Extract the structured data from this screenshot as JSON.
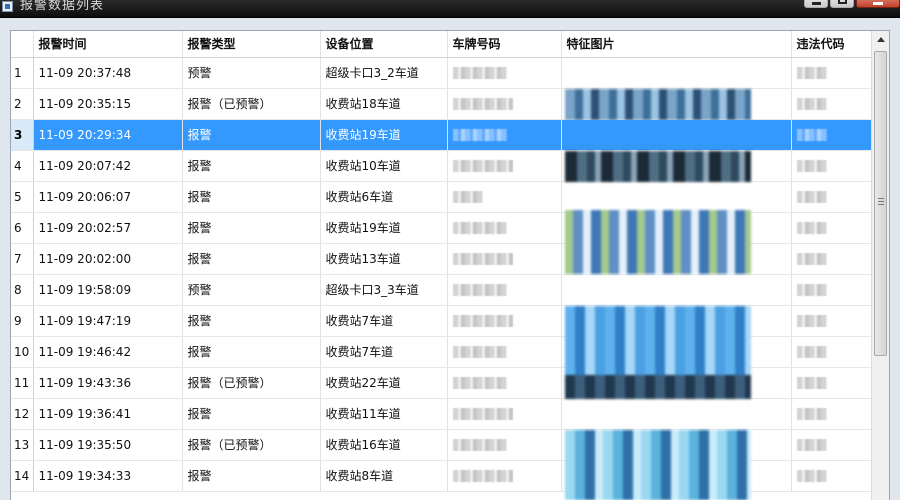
{
  "window": {
    "title": "报警数据列表"
  },
  "table": {
    "headers": [
      "",
      "报警时间",
      "报警类型",
      "设备位置",
      "车牌号码",
      "特征图片",
      "违法代码"
    ],
    "selected_row": 3,
    "rows": [
      {
        "idx": "1",
        "time": "11-09 20:37:48",
        "type": "预警",
        "location": "超级卡口3_2车道"
      },
      {
        "idx": "2",
        "time": "11-09 20:35:15",
        "type": "报警（已预警）",
        "location": "收费站18车道"
      },
      {
        "idx": "3",
        "time": "11-09 20:29:34",
        "type": "报警",
        "location": "收费站19车道"
      },
      {
        "idx": "4",
        "time": "11-09 20:07:42",
        "type": "报警",
        "location": "收费站10车道"
      },
      {
        "idx": "5",
        "time": "11-09 20:06:07",
        "type": "报警",
        "location": "收费站6车道"
      },
      {
        "idx": "6",
        "time": "11-09 20:02:57",
        "type": "报警",
        "location": "收费站19车道"
      },
      {
        "idx": "7",
        "time": "11-09 20:02:00",
        "type": "报警",
        "location": "收费站13车道"
      },
      {
        "idx": "8",
        "time": "11-09 19:58:09",
        "type": "预警",
        "location": "超级卡口3_3车道"
      },
      {
        "idx": "9",
        "time": "11-09 19:47:19",
        "type": "报警",
        "location": "收费站7车道"
      },
      {
        "idx": "10",
        "time": "11-09 19:46:42",
        "type": "报警",
        "location": "收费站7车道"
      },
      {
        "idx": "11",
        "time": "11-09 19:43:36",
        "type": "报警（已预警）",
        "location": "收费站22车道"
      },
      {
        "idx": "12",
        "time": "11-09 19:36:41",
        "type": "报警",
        "location": "收费站11车道"
      },
      {
        "idx": "13",
        "time": "11-09 19:35:50",
        "type": "报警（已预警）",
        "location": "收费站16车道"
      },
      {
        "idx": "14",
        "time": "11-09 19:34:33",
        "type": "报警",
        "location": "收费站8车道"
      }
    ]
  },
  "icons": {
    "app": "window-app-icon",
    "minimize": "minimize-icon",
    "maximize": "maximize-icon",
    "close": "close-icon",
    "scroll_up": "scroll-up-arrow-icon"
  },
  "colors": {
    "selection": "#3399ff",
    "titlebar": "#1a1a1a"
  }
}
